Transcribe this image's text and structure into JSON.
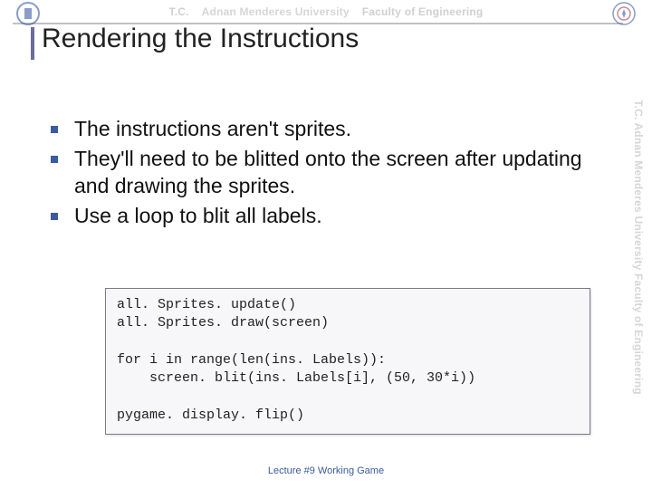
{
  "header": {
    "tc": "T.C.",
    "university": "Adnan Menderes University",
    "faculty": "Faculty of Engineering"
  },
  "title": "Rendering the Instructions",
  "bullets": [
    "The instructions aren't sprites.",
    "They'll need to be blitted onto the screen after updating and drawing the sprites.",
    "Use a loop to blit all labels."
  ],
  "code": "all. Sprites. update()\nall. Sprites. draw(screen)\n\nfor i in range(len(ins. Labels)):\n    screen. blit(ins. Labels[i], (50, 30*i))\n\npygame. display. flip()",
  "footer": "Lecture #9 Working Game",
  "right_band": "T.C.      Adnan Menderes University      Faculty of Engineering"
}
